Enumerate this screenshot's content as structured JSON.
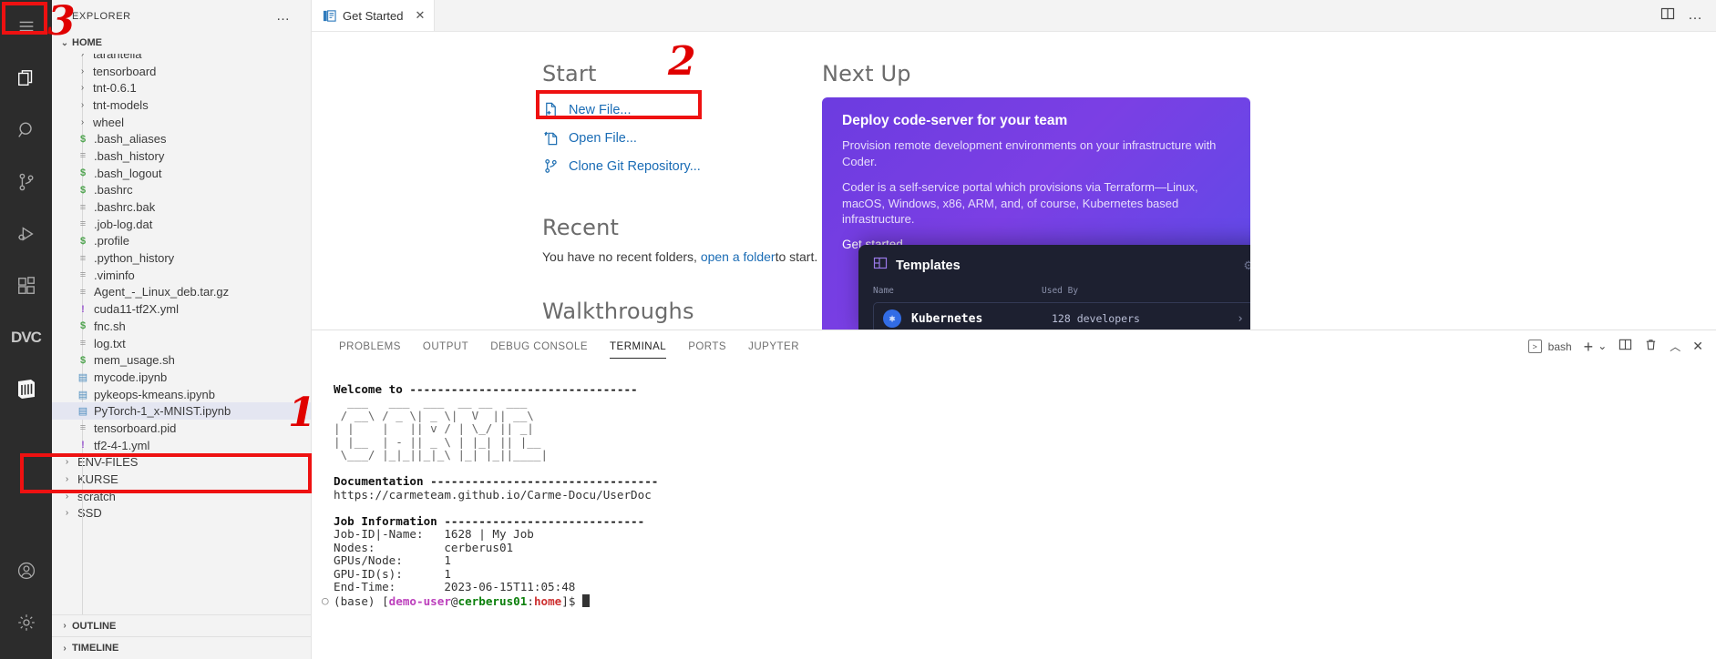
{
  "activity_bar": {
    "items": [
      {
        "name": "menu",
        "glyph": "hamburger"
      },
      {
        "name": "explorer",
        "glyph": "files"
      },
      {
        "name": "search",
        "glyph": "magnifier"
      },
      {
        "name": "source-control",
        "glyph": "branch"
      },
      {
        "name": "run-and-debug",
        "glyph": "play-bug"
      },
      {
        "name": "extensions",
        "glyph": "squares"
      },
      {
        "name": "dvc",
        "glyph": "DVC"
      },
      {
        "name": "jupyter",
        "glyph": "book"
      }
    ],
    "bottom_items": [
      {
        "name": "accounts",
        "glyph": "person"
      },
      {
        "name": "settings",
        "glyph": "gear"
      }
    ]
  },
  "sidebar": {
    "title": "EXPLORER",
    "more_actions": "…",
    "root_section": "HOME",
    "files": [
      {
        "label": "tarantella",
        "kind": "folder",
        "icon": "chevron-right",
        "partial": true
      },
      {
        "label": "tensorboard",
        "kind": "folder",
        "icon": "chevron-right"
      },
      {
        "label": "tnt-0.6.1",
        "kind": "folder",
        "icon": "chevron-right"
      },
      {
        "label": "tnt-models",
        "kind": "folder",
        "icon": "chevron-right"
      },
      {
        "label": "wheel",
        "kind": "folder",
        "icon": "chevron-right"
      },
      {
        "label": ".bash_aliases",
        "kind": "file",
        "icon": "shell-icon"
      },
      {
        "label": ".bash_history",
        "kind": "file",
        "icon": "text-icon"
      },
      {
        "label": ".bash_logout",
        "kind": "file",
        "icon": "shell-icon"
      },
      {
        "label": ".bashrc",
        "kind": "file",
        "icon": "shell-icon"
      },
      {
        "label": ".bashrc.bak",
        "kind": "file",
        "icon": "text-icon"
      },
      {
        "label": ".job-log.dat",
        "kind": "file",
        "icon": "text-icon"
      },
      {
        "label": ".profile",
        "kind": "file",
        "icon": "shell-icon"
      },
      {
        "label": ".python_history",
        "kind": "file",
        "icon": "text-icon"
      },
      {
        "label": ".viminfo",
        "kind": "file",
        "icon": "text-icon"
      },
      {
        "label": "Agent_-_Linux_deb.tar.gz",
        "kind": "file",
        "icon": "text-icon"
      },
      {
        "label": "cuda11-tf2X.yml",
        "kind": "file",
        "icon": "yaml-icon"
      },
      {
        "label": "fnc.sh",
        "kind": "file",
        "icon": "shell-icon"
      },
      {
        "label": "log.txt",
        "kind": "file",
        "icon": "text-icon"
      },
      {
        "label": "mem_usage.sh",
        "kind": "file",
        "icon": "shell-icon"
      },
      {
        "label": "mycode.ipynb",
        "kind": "file",
        "icon": "notebook-icon"
      },
      {
        "label": "pykeops-kmeans.ipynb",
        "kind": "file",
        "icon": "notebook-icon"
      },
      {
        "label": "PyTorch-1_x-MNIST.ipynb",
        "kind": "file",
        "icon": "notebook-icon",
        "selected": true
      },
      {
        "label": "tensorboard.pid",
        "kind": "file",
        "icon": "text-icon"
      },
      {
        "label": "tf2-4-1.yml",
        "kind": "file",
        "icon": "yaml-icon"
      }
    ],
    "root_folders": [
      {
        "label": "ENV-FILES",
        "icon": "chevron-right"
      },
      {
        "label": "KURSE",
        "icon": "chevron-right"
      },
      {
        "label": "scratch",
        "icon": "chevron-right"
      },
      {
        "label": "SSD",
        "icon": "chevron-right"
      }
    ],
    "bottom_sections": [
      {
        "label": "OUTLINE"
      },
      {
        "label": "TIMELINE"
      }
    ]
  },
  "editor": {
    "tab": {
      "label": "Get Started",
      "icon": "get-started-icon",
      "close": "✕"
    },
    "actions": [
      {
        "name": "split-editor-icon"
      },
      {
        "name": "more-actions-icon",
        "glyph": "…"
      }
    ]
  },
  "get_started": {
    "start": {
      "heading": "Start",
      "items": [
        {
          "label": "New File...",
          "icon": "new-file-icon"
        },
        {
          "label": "Open File...",
          "icon": "open-file-icon"
        },
        {
          "label": "Clone Git Repository...",
          "icon": "git-branch-icon"
        }
      ]
    },
    "recent": {
      "heading": "Recent",
      "text_before": "You have no recent folders,",
      "link": "open a folder",
      "text_after": "to start."
    },
    "walkthroughs": {
      "heading": "Walkthroughs"
    },
    "next_up": {
      "heading": "Next Up",
      "card": {
        "title": "Deploy code-server for your team",
        "paragraph1": "Provision remote development environments on your infrastructure with Coder.",
        "paragraph2": "Coder is a self-service portal which provisions via Terraform—Linux, macOS, Windows, x86, ARM, and, of course, Kubernetes based infrastructure.",
        "cta": "Get started",
        "cta_arrow": "→",
        "templates": {
          "title": "Templates",
          "gear": "gear-icon",
          "columns": [
            "Name",
            "Used By"
          ],
          "rows": [
            {
              "name": "Kubernetes",
              "used_by": "128 developers",
              "arrow": "›"
            }
          ]
        }
      }
    }
  },
  "panel": {
    "tabs": [
      {
        "label": "PROBLEMS"
      },
      {
        "label": "OUTPUT"
      },
      {
        "label": "DEBUG CONSOLE"
      },
      {
        "label": "TERMINAL",
        "active": true
      },
      {
        "label": "PORTS"
      },
      {
        "label": "JUPYTER"
      }
    ],
    "shell_label": "bash",
    "actions": [
      {
        "name": "new-terminal-icon",
        "glyph": "+"
      },
      {
        "name": "terminal-dropdown-icon",
        "glyph": "⌄"
      },
      {
        "name": "split-terminal-icon"
      },
      {
        "name": "kill-terminal-icon"
      },
      {
        "name": "maximize-panel-icon",
        "glyph": "︿"
      },
      {
        "name": "close-panel-icon",
        "glyph": "✕"
      }
    ]
  },
  "terminal": {
    "welcome_line": "Welcome to ---------------------------------",
    "ascii_art": [
      "  ___   ___  ___  __ __  ___",
      " / __\\ / _ \\| _ \\|  V  || __\\",
      "| |    |   || v / | \\_/ || _| ",
      "| |__  | - || _ \\ | |_| || |__",
      " \\___/ |_|_||_|_\\ |_| |_||____|"
    ],
    "doc_header": "Documentation ---------------------------------",
    "doc_url": "https://carmeteam.github.io/Carme-Docu/UserDoc",
    "job_header": "Job Information -----------------------------",
    "job_lines": [
      {
        "key": "Job-ID|-Name:",
        "value": "1628 | My Job"
      },
      {
        "key": "Nodes:",
        "value": "cerberus01"
      },
      {
        "key": "GPUs/Node:",
        "value": "1"
      },
      {
        "key": "GPU-ID(s):",
        "value": "1"
      },
      {
        "key": "End-Time:",
        "value": "2023-06-15T11:05:48"
      }
    ],
    "prompt": {
      "env": "(base)",
      "user": "demo-user",
      "at": "@",
      "host": "cerberus01",
      "colon": ":",
      "path": "home",
      "sigil": "]$"
    }
  },
  "annotations": [
    {
      "id": "1",
      "label": "1"
    },
    {
      "id": "2",
      "label": "2"
    },
    {
      "id": "3",
      "label": "3"
    }
  ],
  "colors": {
    "accent_blue": "#1a6cb5",
    "coder_purple": "#7b3fe4",
    "annotation_red": "#ee1111",
    "activitybar_bg": "#2c2c2c",
    "sidebar_bg": "#f3f3f3"
  }
}
